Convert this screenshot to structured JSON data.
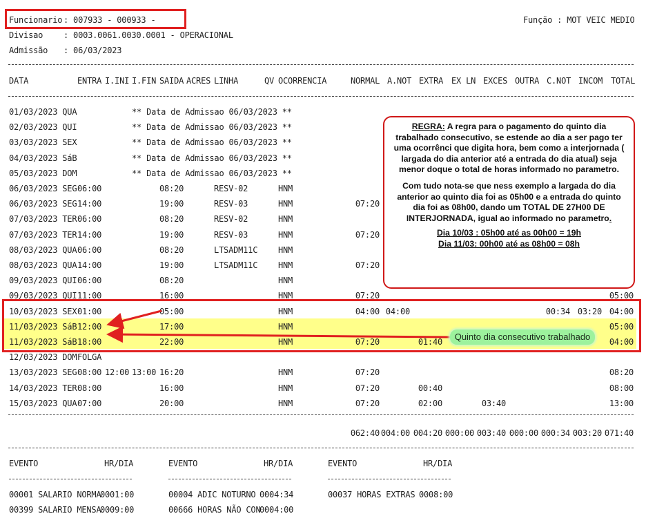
{
  "header": {
    "funcionario_label": "Funcionario",
    "funcionario_value": ": 007933 - 000933 -",
    "funcao": "Função : MOT VEIC MEDIO",
    "divisao_label": "Divisao",
    "divisao_value": ": 0003.0061.0030.0001 - OPERACIONAL",
    "admissao_label": "Admissão",
    "admissao_value": ": 06/03/2023"
  },
  "columns": {
    "data": "DATA",
    "entra": "ENTRA",
    "iini": "I.INI",
    "ifin": "I.FIN",
    "saida": "SAIDA",
    "acres": "ACRES",
    "linha": "LINHA",
    "qv": "QV",
    "ocorrencia": "OCORRENCIA",
    "normal": "NORMAL",
    "anot": "A.NOT",
    "extra": "EXTRA",
    "exln": "EX LN",
    "exces": "EXCES",
    "outra": "OUTRA",
    "cnot": "C.NOT",
    "incom": "INCOM",
    "total": "TOTAL"
  },
  "rows": [
    {
      "date": "01/03/2023 QUA",
      "msg": "** Data de Admissao 06/03/2023 **"
    },
    {
      "date": "02/03/2023 QUI",
      "msg": "** Data de Admissao 06/03/2023 **"
    },
    {
      "date": "03/03/2023 SEX",
      "msg": "** Data de Admissao 06/03/2023 **"
    },
    {
      "date": "04/03/2023 SáB",
      "msg": "** Data de Admissao 06/03/2023 **"
    },
    {
      "date": "05/03/2023 DOM",
      "msg": "** Data de Admissao 06/03/2023 **"
    },
    {
      "date": "06/03/2023 SEG",
      "entra": "06:00",
      "saida": "08:20",
      "linha": "RESV-02",
      "ocorr": "HNM"
    },
    {
      "date": "06/03/2023 SEG",
      "entra": "14:00",
      "saida": "19:00",
      "linha": "RESV-03",
      "ocorr": "HNM",
      "normal": "07:20"
    },
    {
      "date": "07/03/2023 TER",
      "entra": "06:00",
      "saida": "08:20",
      "linha": "RESV-02",
      "ocorr": "HNM"
    },
    {
      "date": "07/03/2023 TER",
      "entra": "14:00",
      "saida": "19:00",
      "linha": "RESV-03",
      "ocorr": "HNM",
      "normal": "07:20"
    },
    {
      "date": "08/03/2023 QUA",
      "entra": "06:00",
      "saida": "08:20",
      "linha": "LTSADM11C",
      "ocorr": "HNM"
    },
    {
      "date": "08/03/2023 QUA",
      "entra": "14:00",
      "saida": "19:00",
      "linha": "LTSADM11C",
      "ocorr": "HNM",
      "normal": "07:20"
    },
    {
      "date": "09/03/2023 QUI",
      "entra": "06:00",
      "saida": "08:20",
      "ocorr": "HNM"
    },
    {
      "date": "09/03/2023 QUI",
      "entra": "11:00",
      "saida": "16:00",
      "ocorr": "HNM",
      "normal": "07:20",
      "total": "05:00"
    },
    {
      "date": "10/03/2023 SEX",
      "entra": "01:00",
      "saida": "05:00",
      "ocorr": "HNM",
      "normal": "04:00",
      "anot": "04:00",
      "cnot": "00:34",
      "incom": "03:20",
      "total": "04:00"
    },
    {
      "date": "11/03/2023 SáB",
      "entra": "12:00",
      "saida": "17:00",
      "ocorr": "HNM",
      "total": "05:00"
    },
    {
      "date": "11/03/2023 SáB",
      "entra": "18:00",
      "saida": "22:00",
      "ocorr": "HNM",
      "normal": "07:20",
      "extra": "01:40",
      "total": "04:00"
    },
    {
      "date": "12/03/2023 DOM",
      "entra": "FOLGA"
    },
    {
      "date": "13/03/2023 SEG",
      "entra": "08:00",
      "iini": "12:00",
      "ifin": "13:00",
      "saida": "16:20",
      "ocorr": "HNM",
      "normal": "07:20",
      "total": "08:20"
    },
    {
      "date": "14/03/2023 TER",
      "entra": "08:00",
      "saida": "16:00",
      "ocorr": "HNM",
      "normal": "07:20",
      "extra": "00:40",
      "total": "08:00"
    },
    {
      "date": "15/03/2023 QUA",
      "entra": "07:00",
      "saida": "20:00",
      "ocorr": "HNM",
      "normal": "07:20",
      "extra": "02:00",
      "exces": "03:40",
      "total": "13:00"
    }
  ],
  "totals": {
    "normal": "062:40",
    "anot": "004:00",
    "extra": "004:20",
    "exln": "000:00",
    "exces": "003:40",
    "outra": "000:00",
    "cnot": "000:34",
    "incom": "003:20",
    "total": "071:40"
  },
  "events": {
    "header_evento": "EVENTO",
    "header_hrdia": "HR/DIA",
    "underline": "--------------------------",
    "items": [
      {
        "code": "00001 SALARIO NORMA",
        "hr": "0001:00"
      },
      {
        "code": "00004 ADIC NOTURNO",
        "hr": "0004:34"
      },
      {
        "code": "00037 HORAS EXTRAS",
        "hr": "0008:00"
      },
      {
        "code": "00399 SALARIO MENSA",
        "hr": "0009:00"
      },
      {
        "code": "00666 HORAS NÃO CON",
        "hr": "0004:00"
      }
    ]
  },
  "note": {
    "rule_label": "REGRA:",
    "rule_text": " A regra para o pagamento do quinto dia trabalhado consecutivo, se estende ao dia a ser pago ter uma ocorrênci que digita hora, bem como a interjornada ( largada do dia anterior até a entrada do dia atual) seja menor doque o total de horas informado no parametro.",
    "example_text": "Com tudo nota-se que ness exemplo a largada do dia anterior ao quinto dia foi as 05h00 e a entrada do quinto dia foi as 08h00, dando um TOTAL DE 27H00 DE INTERJORNADA, igual ao informado no parametro",
    "example_end": ".",
    "calc1": "Dia 10/03 : 05h00 até as 00h00 = 19h",
    "calc2": "Dia 11/03:  00h00 até as 08h00 = 08h"
  },
  "callout": {
    "label": "Quinto dia consecutivo trabalhado"
  },
  "colors": {
    "highlight_box": "#e02020",
    "highlight_fill": "#ffff8a",
    "callout_fill": "#9df29d"
  }
}
